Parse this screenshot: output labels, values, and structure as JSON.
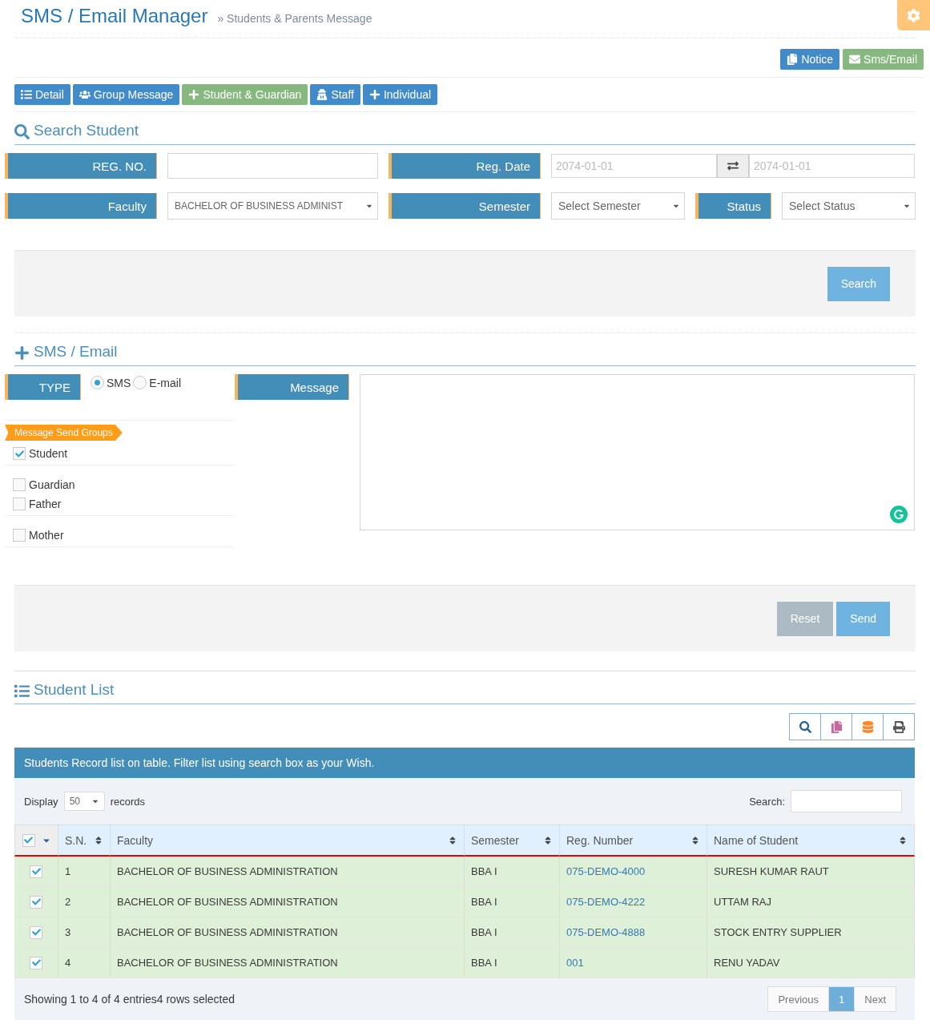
{
  "header": {
    "title": "SMS / Email Manager",
    "breadcrumb": "» Students & Parents Message"
  },
  "top_actions": [
    {
      "label": "Notice",
      "selected": false
    },
    {
      "label": "Sms/Email",
      "selected": true
    }
  ],
  "nav_buttons": [
    {
      "label": "Detail",
      "selected": false
    },
    {
      "label": "Group Message",
      "selected": false
    },
    {
      "label": "Student & Guardian",
      "selected": true
    },
    {
      "label": "Staff",
      "selected": false
    },
    {
      "label": "Individual",
      "selected": false
    }
  ],
  "search_section": {
    "title": "Search Student",
    "reg_no": {
      "label": "REG. NO."
    },
    "reg_date": {
      "label": "Reg. Date",
      "from_placeholder": "2074-01-01",
      "to_placeholder": "2074-01-01"
    },
    "faculty": {
      "label": "Faculty",
      "value": "BACHELOR OF BUSINESS ADMINIST"
    },
    "semester": {
      "label": "Semester",
      "value": "Select Semester"
    },
    "status": {
      "label": "Status",
      "value": "Select Status"
    },
    "search_button": "Search"
  },
  "sms_section": {
    "title": "SMS / Email",
    "type_label": "TYPE",
    "type_options": [
      {
        "label": "SMS",
        "selected": true
      },
      {
        "label": "E-mail",
        "selected": false
      }
    ],
    "message_label": "Message",
    "groups_ribbon": "Message Send Groups",
    "groups": [
      {
        "label": "Student",
        "checked": true
      },
      {
        "label": "Guardian",
        "checked": false
      },
      {
        "label": "Father",
        "checked": false
      },
      {
        "label": "Mother",
        "checked": false
      }
    ],
    "reset_button": "Reset",
    "send_button": "Send"
  },
  "student_list": {
    "title": "Student List",
    "banner": "Students Record list on table. Filter list using search box as your Wish.",
    "display_label": "Display",
    "page_length": "50",
    "records_label": "records",
    "search_label": "Search:",
    "all_checked": true,
    "columns": [
      "S.N.",
      "Faculty",
      "Semester",
      "Reg. Number",
      "Name of Student"
    ],
    "rows": [
      {
        "selected": true,
        "cells": [
          "1",
          "BACHELOR OF BUSINESS ADMINISTRATION",
          "BBA I",
          "075-DEMO-4000",
          "SURESH KUMAR RAUT"
        ]
      },
      {
        "selected": true,
        "cells": [
          "2",
          "BACHELOR OF BUSINESS ADMINISTRATION",
          "BBA I",
          "075-DEMO-4222",
          "UTTAM RAJ"
        ]
      },
      {
        "selected": true,
        "cells": [
          "3",
          "BACHELOR OF BUSINESS ADMINISTRATION",
          "BBA I",
          "075-DEMO-4888",
          "STOCK ENTRY SUPPLIER"
        ]
      },
      {
        "selected": true,
        "cells": [
          "4",
          "BACHELOR OF BUSINESS ADMINISTRATION",
          "BBA I",
          "001",
          "RENU YADAV"
        ]
      }
    ],
    "info": "Showing 1 to 4 of 4 entries4 rows selected",
    "pagination": {
      "previous": "Previous",
      "pages": [
        {
          "label": "1",
          "selected": true
        }
      ],
      "next": "Next"
    }
  }
}
